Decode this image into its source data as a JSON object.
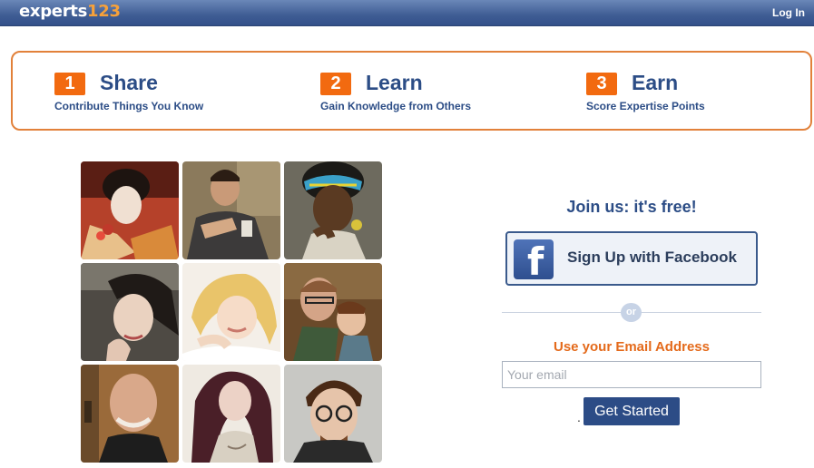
{
  "header": {
    "logo_text": "experts",
    "logo_num": "123",
    "login_label": "Log In"
  },
  "steps": [
    {
      "num": "1",
      "title": "Share",
      "subtitle": "Contribute Things You Know"
    },
    {
      "num": "2",
      "title": "Learn",
      "subtitle": "Gain Knowledge from Others"
    },
    {
      "num": "3",
      "title": "Earn",
      "subtitle": "Score Expertise Points"
    }
  ],
  "photos": [
    {
      "icon": "person-photo-1"
    },
    {
      "icon": "person-photo-2"
    },
    {
      "icon": "person-photo-3"
    },
    {
      "icon": "person-photo-4"
    },
    {
      "icon": "person-photo-5"
    },
    {
      "icon": "person-photo-6"
    },
    {
      "icon": "person-photo-7"
    },
    {
      "icon": "person-photo-8"
    },
    {
      "icon": "person-photo-9"
    }
  ],
  "signup": {
    "join_text": "Join us: it's free!",
    "facebook_label": "Sign Up with Facebook",
    "facebook_icon": "facebook-icon",
    "or_text": "or",
    "email_label": "Use your Email Address",
    "email_placeholder": "Your email",
    "email_value": "",
    "dot_text": ".",
    "submit_label": "Get Started"
  },
  "colors": {
    "brand_blue": "#2c4d86",
    "accent_orange": "#f26a10",
    "header_blue": "#3f5d94"
  }
}
